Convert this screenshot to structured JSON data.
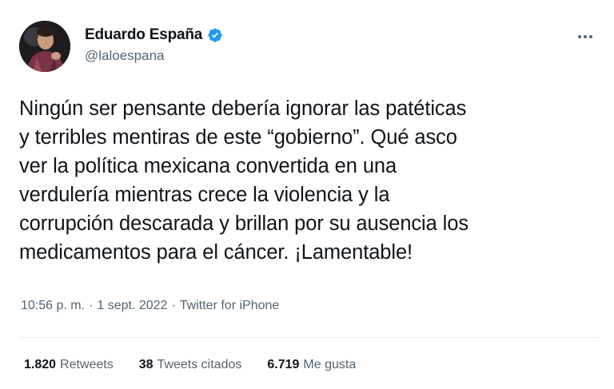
{
  "author": {
    "display_name": "Eduardo España",
    "handle": "@laloespana",
    "verified": true,
    "verified_color": "#1d9bf0"
  },
  "tweet": {
    "lines": [
      "Ningún ser pensante debería ignorar las patéticas",
      "y terribles mentiras de este “gobierno”. Qué asco",
      "ver la política mexicana convertida en una",
      "verdulería mientras crece la violencia y la",
      "corrupción descarada y brillan por su ausencia los",
      "medicamentos para el cáncer. ¡Lamentable!"
    ]
  },
  "meta": {
    "time": "10:56 p. m.",
    "separator": "·",
    "date": "1 sept. 2022",
    "source": "Twitter for iPhone"
  },
  "stats": {
    "retweets": {
      "count": "1.820",
      "label": "Retweets"
    },
    "quotes": {
      "count": "38",
      "label": "Tweets citados"
    },
    "likes": {
      "count": "6.719",
      "label": "Me gusta"
    }
  },
  "icons": {
    "verified": "verified-badge-icon",
    "more": "more-options-icon"
  }
}
